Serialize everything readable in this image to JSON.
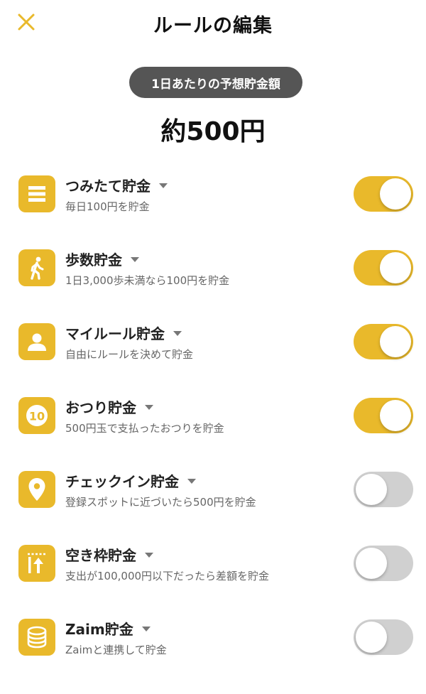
{
  "header": {
    "title": "ルールの編集"
  },
  "pill_label": "1日あたりの予想貯金額",
  "estimate": "約500円",
  "colors": {
    "accent": "#e9b92b",
    "toggle_off": "#d0d0d0",
    "pill": "#555555"
  },
  "rules": [
    {
      "icon": "list-icon",
      "title": "つみたて貯金",
      "desc": "毎日100円を貯金",
      "enabled": true
    },
    {
      "icon": "walking-icon",
      "title": "歩数貯金",
      "desc": "1日3,000歩未満なら100円を貯金",
      "enabled": true
    },
    {
      "icon": "person-icon",
      "title": "マイルール貯金",
      "desc": "自由にルールを決めて貯金",
      "enabled": true
    },
    {
      "icon": "coin-10-icon",
      "title": "おつり貯金",
      "desc": "500円玉で支払ったおつりを貯金",
      "enabled": true
    },
    {
      "icon": "location-pin-icon",
      "title": "チェックイン貯金",
      "desc": "登録スポットに近づいたら500円を貯金",
      "enabled": false
    },
    {
      "icon": "up-arrow-icon",
      "title": "空き枠貯金",
      "desc": "支出が100,000円以下だったら差額を貯金",
      "enabled": false
    },
    {
      "icon": "coin-stack-icon",
      "title": "Zaim貯金",
      "desc": "Zaimと連携して貯金",
      "enabled": false
    }
  ]
}
